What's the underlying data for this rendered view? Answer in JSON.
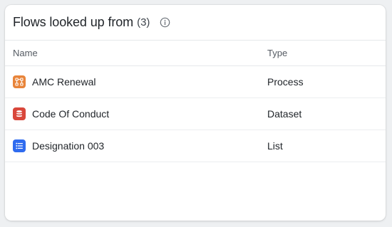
{
  "panel": {
    "title": "Flows looked up from",
    "count": "(3)",
    "info_icon": "info-circle-icon"
  },
  "table": {
    "columns": [
      "Name",
      "Type"
    ],
    "rows": [
      {
        "name": "AMC Renewal",
        "type": "Process",
        "icon": "process-icon",
        "icon_color": "#e8843a"
      },
      {
        "name": "Code Of Conduct",
        "type": "Dataset",
        "icon": "dataset-icon",
        "icon_color": "#d9473b"
      },
      {
        "name": "Designation 003",
        "type": "List",
        "icon": "list-icon",
        "icon_color": "#2f6bef"
      }
    ]
  },
  "colors": {
    "border": "#e6e8eb",
    "text_primary": "#1f2328",
    "text_secondary": "#555b63"
  }
}
